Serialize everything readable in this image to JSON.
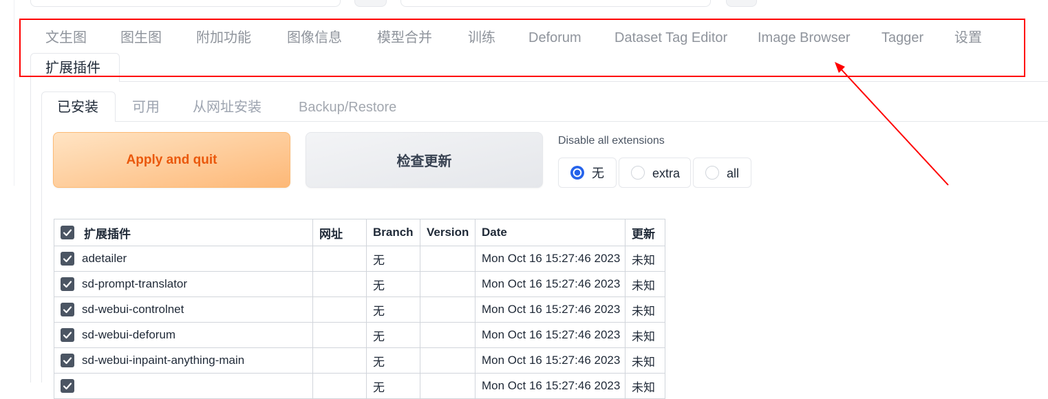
{
  "main_tabs": [
    {
      "label": "文生图"
    },
    {
      "label": "图生图"
    },
    {
      "label": "附加功能"
    },
    {
      "label": "图像信息"
    },
    {
      "label": "模型合并"
    },
    {
      "label": "训练"
    },
    {
      "label": "Deforum"
    },
    {
      "label": "Dataset Tag Editor"
    },
    {
      "label": "Image Browser"
    },
    {
      "label": "Tagger"
    },
    {
      "label": "设置"
    },
    {
      "label": "扩展插件",
      "selected": true
    }
  ],
  "sub_tabs": [
    {
      "label": "已安装",
      "selected": true
    },
    {
      "label": "可用"
    },
    {
      "label": "从网址安装"
    },
    {
      "label": "Backup/Restore"
    }
  ],
  "actions": {
    "apply_label": "Apply and quit",
    "check_updates_label": "检查更新"
  },
  "disable_all": {
    "label": "Disable all extensions",
    "options": [
      "无",
      "extra",
      "all"
    ],
    "selected": "无"
  },
  "table": {
    "select_all_checked": true,
    "headers": {
      "name": "扩展插件",
      "url": "网址",
      "branch": "Branch",
      "version": "Version",
      "date": "Date",
      "update": "更新"
    },
    "rows": [
      {
        "checked": true,
        "name": "adetailer",
        "url": "",
        "branch": "无",
        "version": "",
        "date": "Mon Oct 16 15:27:46 2023",
        "update": "未知"
      },
      {
        "checked": true,
        "name": "sd-prompt-translator",
        "url": "",
        "branch": "无",
        "version": "",
        "date": "Mon Oct 16 15:27:46 2023",
        "update": "未知"
      },
      {
        "checked": true,
        "name": "sd-webui-controlnet",
        "url": "",
        "branch": "无",
        "version": "",
        "date": "Mon Oct 16 15:27:46 2023",
        "update": "未知"
      },
      {
        "checked": true,
        "name": "sd-webui-deforum",
        "url": "",
        "branch": "无",
        "version": "",
        "date": "Mon Oct 16 15:27:46 2023",
        "update": "未知"
      },
      {
        "checked": true,
        "name": "sd-webui-inpaint-anything-main",
        "url": "",
        "branch": "无",
        "version": "",
        "date": "Mon Oct 16 15:27:46 2023",
        "update": "未知"
      },
      {
        "checked": true,
        "name": "",
        "url": "",
        "branch": "无",
        "version": "",
        "date": "Mon Oct 16 15:27:46 2023",
        "update": "未知"
      }
    ]
  },
  "colors": {
    "accent": "#2563eb",
    "apply_text": "#ea580c",
    "apply_bg": "#fdba74",
    "annotation": "#ff0000",
    "checkbox": "#4b5563"
  },
  "icons": {
    "checkbox": "checkbox-checked-icon",
    "radio_selected": "radio-selected-icon",
    "radio_unselected": "radio-unselected-icon",
    "annotation": "red-highlight-box-and-arrow"
  }
}
